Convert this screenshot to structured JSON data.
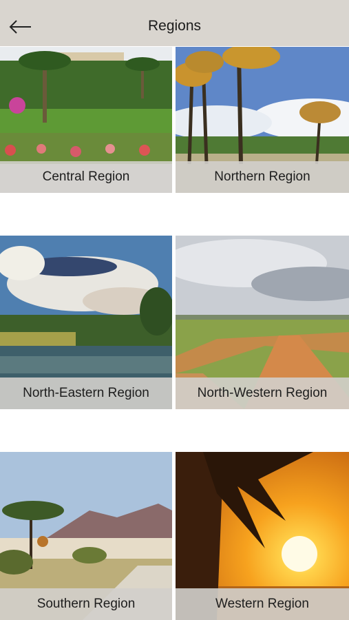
{
  "header": {
    "title": "Regions",
    "back_icon": "arrow-left-icon"
  },
  "regions": [
    {
      "label": "Central Region",
      "scene": "garden"
    },
    {
      "label": "Northern Region",
      "scene": "palms"
    },
    {
      "label": "North-Eastern Region",
      "scene": "river"
    },
    {
      "label": "North-Western Region",
      "scene": "road"
    },
    {
      "label": "Southern Region",
      "scene": "desert"
    },
    {
      "label": "Western Region",
      "scene": "sunset"
    }
  ]
}
